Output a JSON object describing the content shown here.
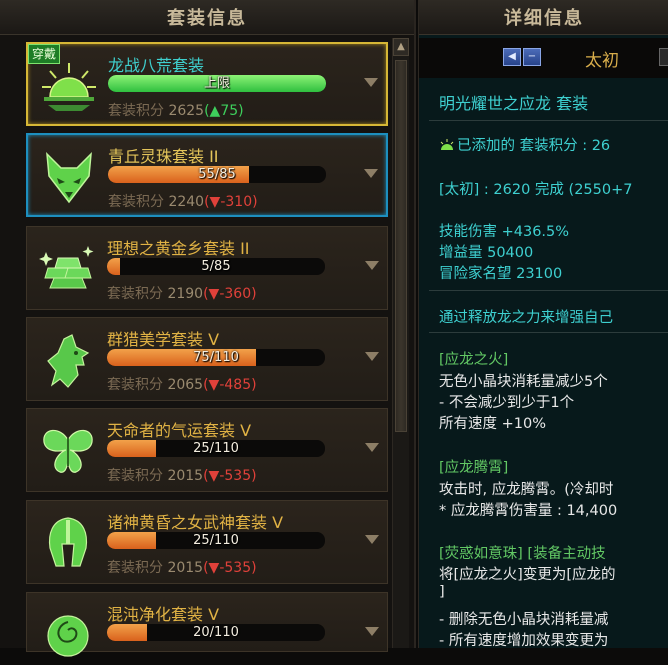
{
  "left_panel": {
    "title": "套装信息",
    "sets": [
      {
        "name": "龙战八荒套装",
        "badge": "穿戴",
        "progress_text": "上限",
        "progress": 1.0,
        "score_label": "套装积分",
        "score": "2625",
        "delta": "(▲75)",
        "delta_dir": "up",
        "state": "equipped",
        "icon": "rising-sun-icon"
      },
      {
        "name": "青丘灵珠套装 II",
        "progress_text": "55/85",
        "progress": 0.647,
        "score_label": "套装积分",
        "score": "2240",
        "delta": "(▼-310)",
        "delta_dir": "down",
        "state": "selected",
        "icon": "fox-icon"
      },
      {
        "name": "理想之黄金乡套装 II",
        "progress_text": "5/85",
        "progress": 0.059,
        "score_label": "套装积分",
        "score": "2190",
        "delta": "(▼-360)",
        "delta_dir": "down",
        "state": "normal",
        "icon": "gold-bars-icon"
      },
      {
        "name": "群猎美学套装 V",
        "progress_text": "75/110",
        "progress": 0.682,
        "score_label": "套装积分",
        "score": "2065",
        "delta": "(▼-485)",
        "delta_dir": "down",
        "state": "normal",
        "icon": "wolf-icon"
      },
      {
        "name": "天命者的气运套装 V",
        "progress_text": "25/110",
        "progress": 0.227,
        "score_label": "套装积分",
        "score": "2015",
        "delta": "(▼-535)",
        "delta_dir": "down",
        "state": "normal",
        "icon": "butterfly-icon"
      },
      {
        "name": "诸神黄昏之女武神套装 V",
        "progress_text": "25/110",
        "progress": 0.227,
        "score_label": "套装积分",
        "score": "2015",
        "delta": "(▼-535)",
        "delta_dir": "down",
        "state": "normal",
        "icon": "valkyrie-helmet-icon"
      },
      {
        "name": "混沌净化套装 V",
        "progress_text": "20/110",
        "progress": 0.182,
        "score_label": "",
        "score": "",
        "delta": "",
        "delta_dir": "",
        "state": "normal",
        "icon": "rose-icon"
      }
    ]
  },
  "right_panel": {
    "title": "详细信息",
    "tier": {
      "label": "太初",
      "prev_icon": "◀",
      "minus_icon": "−"
    },
    "lines": {
      "set_title": "明光耀世之应龙  套装",
      "added_score": "已添加的 套装积分 : 26",
      "completion": "[太初] : 2620 完成 (2550+7",
      "skill_damage": "技能伤害 +436.5%",
      "gain": "增益量 50400",
      "fame": "冒险家名望 23100",
      "desc": "通过释放龙之力来增强自己",
      "fire_title": "[应龙之火]",
      "fire_1": "无色小晶块消耗量减少5个",
      "fire_2": "- 不会减少到少于1个",
      "fire_3": "所有速度 +10%",
      "soar_title": "[应龙腾霄]",
      "soar_1": "攻击时, 应龙腾霄。(冷却时",
      "soar_2": "* 应龙腾霄伤害量 : 14,400",
      "pearl_title": "[荧惑如意珠] [装备主动技",
      "pearl_1": "将[应龙之火]变更为[应龙的",
      "pearl_2": "]",
      "pearl_3": "- 删除无色小晶块消耗量减",
      "pearl_4": "- 所有速度增加效果变更为"
    }
  }
}
